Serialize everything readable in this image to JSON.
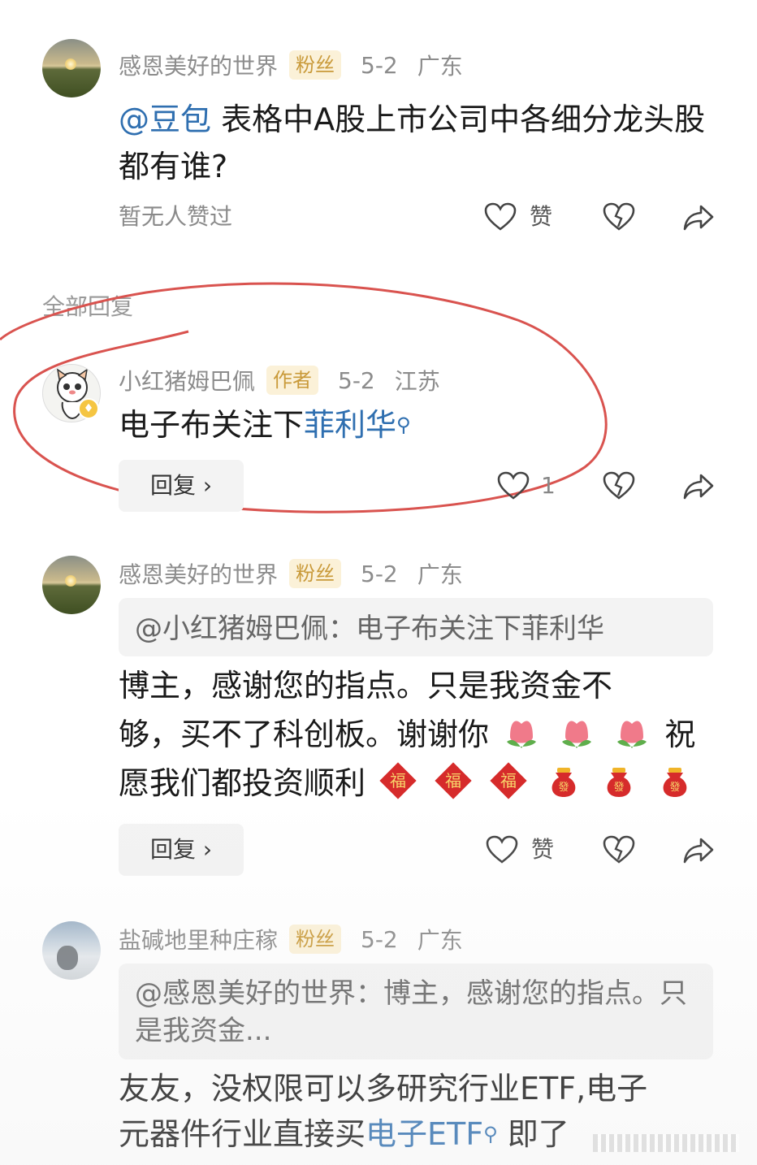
{
  "comment1": {
    "username": "感恩美好的世界",
    "tag": "粉丝",
    "date": "5-2",
    "location": "广东",
    "mention": "@豆包",
    "text": " 表格中A股上市公司中各细分龙头股都有谁?",
    "no_likes_text": "暂无人赞过",
    "like_label": "赞"
  },
  "section_title": "全部回复",
  "reply1": {
    "username": "小红猪姆巴佩",
    "tag": "作者",
    "date": "5-2",
    "location": "江苏",
    "text": "电子布关注下",
    "link_text": "菲利华",
    "reply_button": "回复",
    "like_count": "1"
  },
  "reply2": {
    "username": "感恩美好的世界",
    "tag": "粉丝",
    "date": "5-2",
    "location": "广东",
    "quote": "@小红猪姆巴佩：电子布关注下菲利华",
    "text_line1": "博主，感谢您的指点。只是我资金不",
    "text_line2": "够，买不了科创板。谢谢你",
    "text_line2b": "祝",
    "text_line3": "愿我们都投资顺利",
    "reply_button": "回复",
    "like_label": "赞"
  },
  "reply3": {
    "username": "盐碱地里种庄稼",
    "tag": "粉丝",
    "date": "5-2",
    "location": "广东",
    "quote": "@感恩美好的世界：博主，感谢您的指点。只是我资金...",
    "text_line1": "友友，没权限可以多研究行业ETF,电子",
    "text_line2": "元器件行业直接买",
    "link_text": "电子ETF",
    "text_line2b": " 即了"
  },
  "colors": {
    "link": "#2f6fb0",
    "tag_bg": "#fbf1d8",
    "tag_fg": "#c99a3a",
    "annotation": "#d9534f"
  }
}
